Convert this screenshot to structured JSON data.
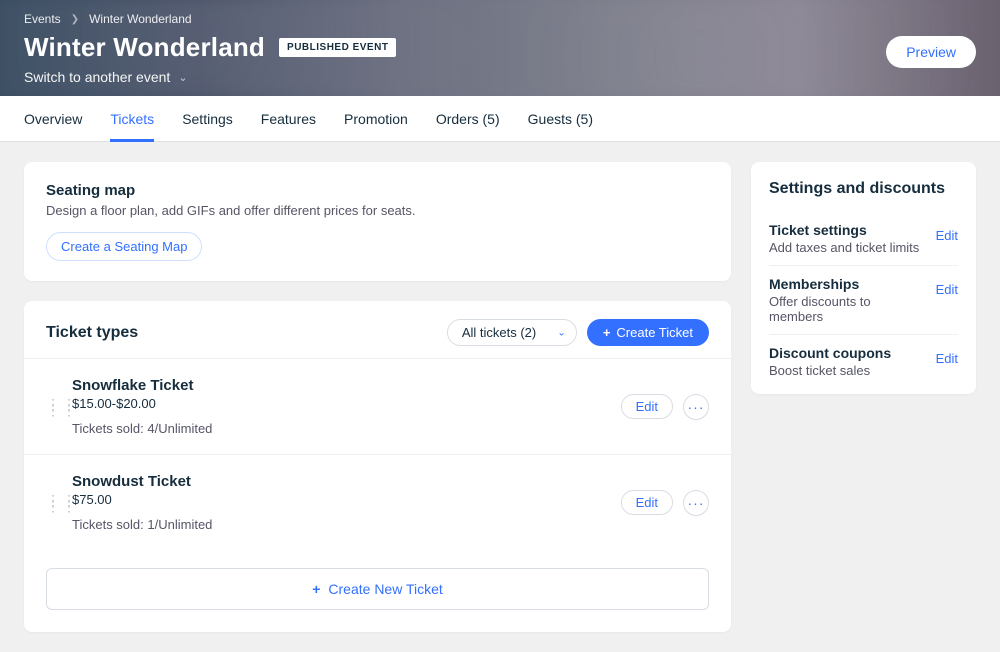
{
  "breadcrumb": {
    "root": "Events",
    "current": "Winter Wonderland"
  },
  "header": {
    "title": "Winter Wonderland",
    "badge": "PUBLISHED EVENT",
    "switch_label": "Switch to another event",
    "preview_label": "Preview"
  },
  "tabs": {
    "overview": "Overview",
    "tickets": "Tickets",
    "settings": "Settings",
    "features": "Features",
    "promotion": "Promotion",
    "orders": "Orders (5)",
    "guests": "Guests (5)"
  },
  "seatmap": {
    "title": "Seating map",
    "desc": "Design a floor plan, add GIFs and offer different prices for seats.",
    "cta": "Create a Seating Map"
  },
  "ticket_section": {
    "title": "Ticket types",
    "filter_label": "All tickets (2)",
    "create_label": "Create Ticket",
    "create_new_label": "Create New Ticket",
    "edit_label": "Edit"
  },
  "tickets": [
    {
      "name": "Snowflake Ticket",
      "price": "$15.00-$20.00",
      "sold": "Tickets sold: 4/Unlimited"
    },
    {
      "name": "Snowdust Ticket",
      "price": "$75.00",
      "sold": "Tickets sold: 1/Unlimited"
    }
  ],
  "sidebar": {
    "title": "Settings and discounts",
    "edit_label": "Edit",
    "items": [
      {
        "title": "Ticket settings",
        "desc": "Add taxes and ticket limits"
      },
      {
        "title": "Memberships",
        "desc": "Offer discounts to members"
      },
      {
        "title": "Discount coupons",
        "desc": "Boost ticket sales"
      }
    ]
  }
}
